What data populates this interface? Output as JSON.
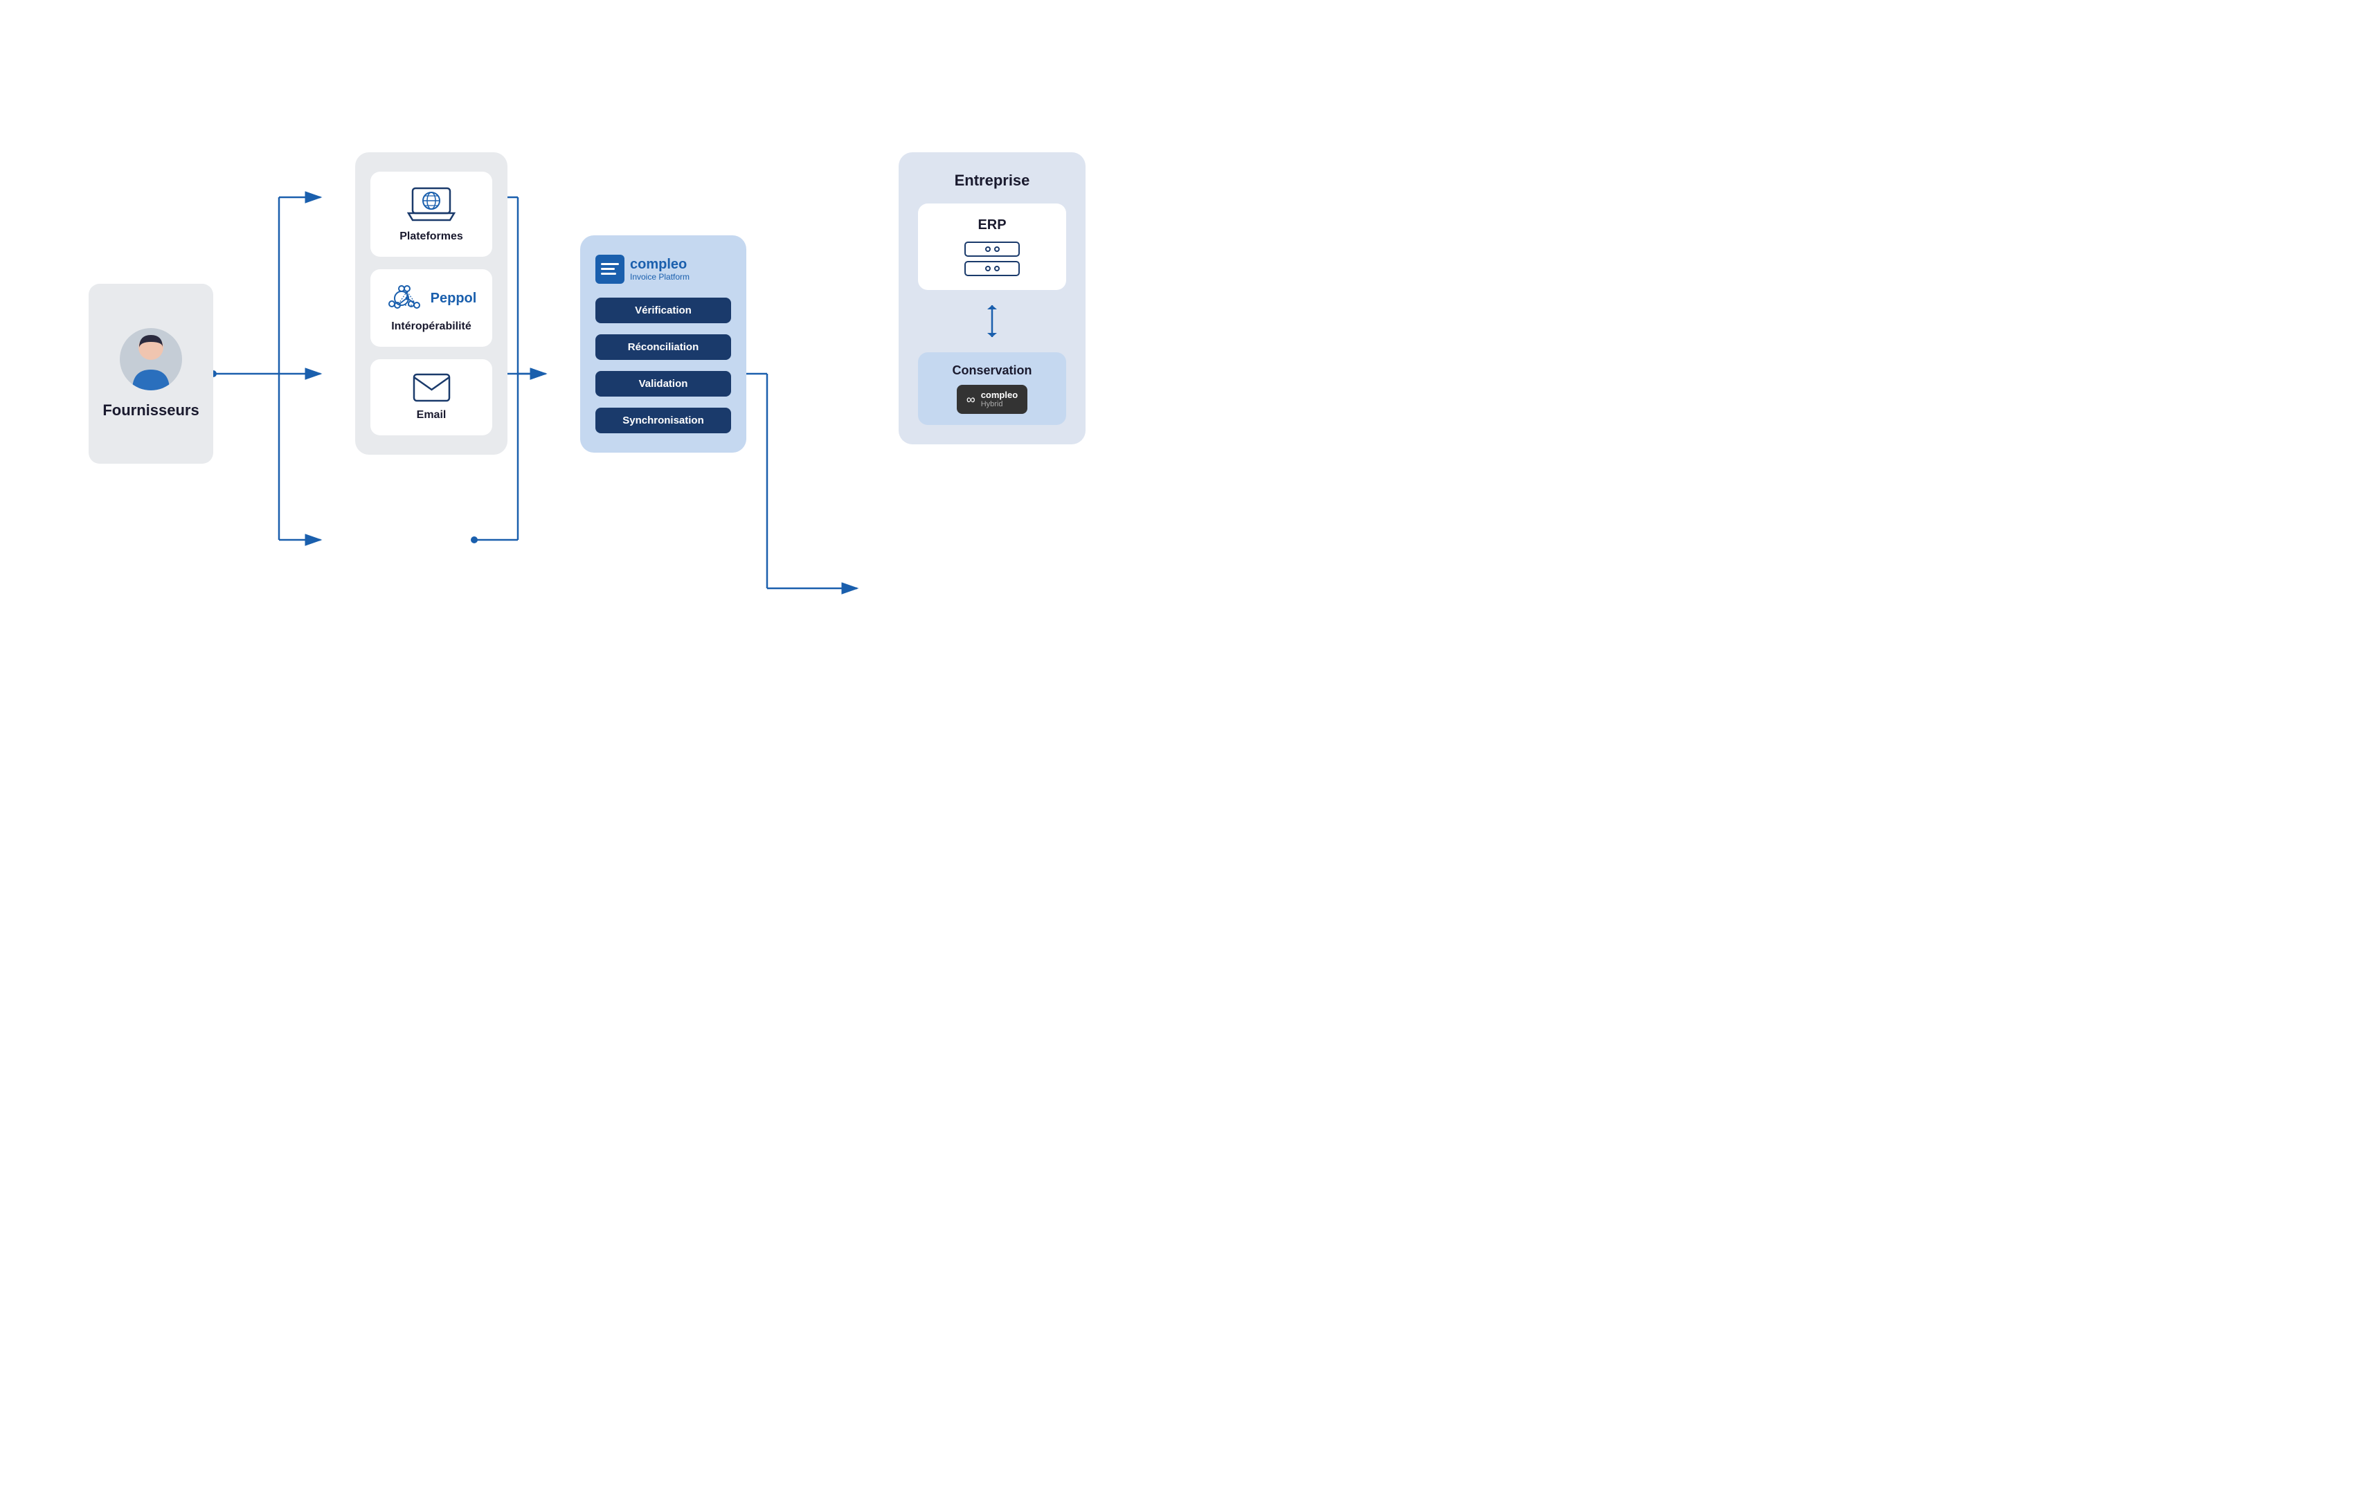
{
  "fournisseurs": {
    "label": "Fournisseurs"
  },
  "channels": {
    "plateformes": {
      "label": "Plateformes"
    },
    "interoperabilite": {
      "label": "Intéropérabilité"
    },
    "email": {
      "label": "Email"
    }
  },
  "compleo": {
    "title": "compleo",
    "subtitle": "Invoice Platform",
    "processes": [
      {
        "label": "Vérification"
      },
      {
        "label": "Réconciliation"
      },
      {
        "label": "Validation"
      },
      {
        "label": "Synchronisation"
      }
    ]
  },
  "entreprise": {
    "title": "Entreprise",
    "erp": {
      "label": "ERP"
    },
    "conservation": {
      "label": "Conservation"
    },
    "hybrid": {
      "compleo": "compleo",
      "sub": "Hybrid"
    }
  },
  "colors": {
    "dark_blue": "#1a3a6b",
    "medium_blue": "#1a5fad",
    "light_blue_bg": "#c5d8f0",
    "gray_bg": "#e8eaed",
    "white": "#ffffff"
  }
}
